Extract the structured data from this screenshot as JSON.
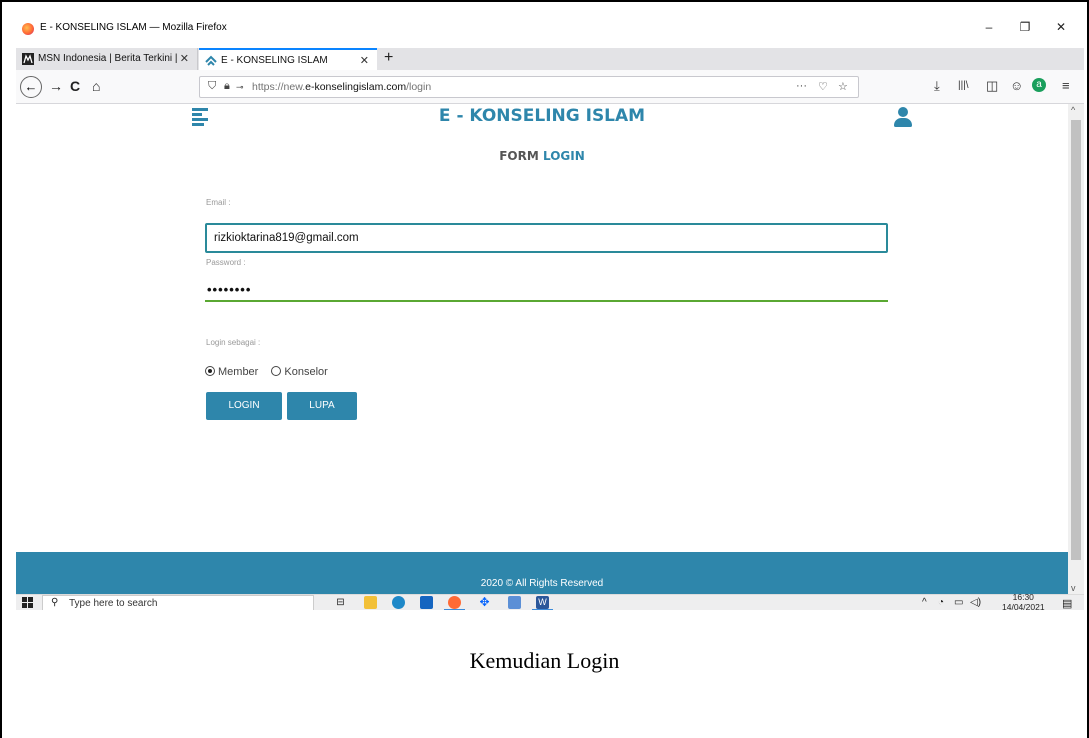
{
  "window": {
    "title": "E - KONSELING ISLAM — Mozilla Firefox",
    "controls": {
      "minimize": "–",
      "restore": "❐",
      "close": "✕"
    }
  },
  "tabs": [
    {
      "label": "MSN Indonesia | Berita Terkini |",
      "close": "✕",
      "icon": "msn-icon"
    },
    {
      "label": "E - KONSELING ISLAM",
      "close": "✕",
      "icon": "site-icon"
    }
  ],
  "new_tab": "+",
  "nav": {
    "back": "←",
    "forward": "→",
    "reload": "C",
    "home": "⌂",
    "url_prefix": "https://new.",
    "url_domain": "e-konselingislam.com",
    "url_path": "/login",
    "more": "···",
    "pocket": "♡",
    "star": "☆",
    "tools": [
      "⤓",
      "|||\\",
      "◫",
      "☺",
      "a",
      "≡"
    ]
  },
  "site": {
    "brand": "E - KONSELING ISLAM",
    "form_title_prefix": "FORM ",
    "form_title_highlight": "LOGIN",
    "email_label": "Email :",
    "email_value": "rizkioktarina819@gmail.com",
    "password_label": "Password :",
    "password_value": "••••••••",
    "role_label": "Login sebagai :",
    "role_options": [
      {
        "label": "Member",
        "selected": true
      },
      {
        "label": "Konselor",
        "selected": false
      }
    ],
    "login_button": "LOGIN",
    "forgot_button": "LUPA",
    "footer": "2020 © All Rights Reserved",
    "accent_color": "#2e86ab"
  },
  "taskbar": {
    "search_placeholder": "Type here to search",
    "time": "16:30",
    "date": "14/04/2021"
  },
  "caption": "Kemudian Login"
}
